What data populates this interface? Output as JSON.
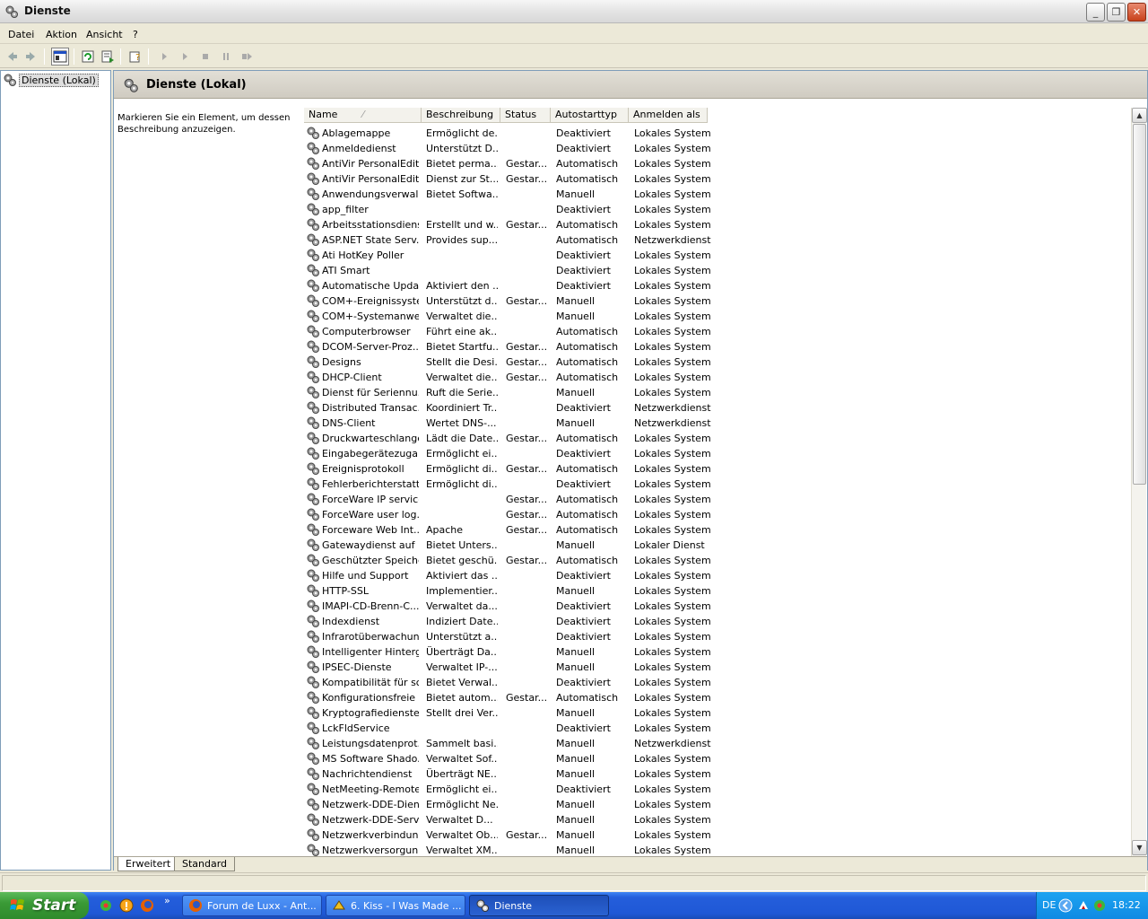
{
  "window": {
    "title": "Dienste"
  },
  "menu": [
    "Datei",
    "Aktion",
    "Ansicht",
    "?"
  ],
  "tree": {
    "root": "Dienste (Lokal)"
  },
  "pane": {
    "title": "Dienste (Lokal)",
    "description": "Markieren Sie ein Element, um dessen Beschreibung anzuzeigen."
  },
  "columns": [
    "Name",
    "Beschreibung",
    "Status",
    "Autostarttyp",
    "Anmelden als"
  ],
  "services": [
    [
      "Ablagemappe",
      "Ermöglicht de...",
      "",
      "Deaktiviert",
      "Lokales System"
    ],
    [
      "Anmeldedienst",
      "Unterstützt D...",
      "",
      "Deaktiviert",
      "Lokales System"
    ],
    [
      "AntiVir PersonalEditi...",
      "Bietet perma...",
      "Gestar...",
      "Automatisch",
      "Lokales System"
    ],
    [
      "AntiVir PersonalEditi...",
      "Dienst zur St...",
      "Gestar...",
      "Automatisch",
      "Lokales System"
    ],
    [
      "Anwendungsverwal...",
      "Bietet Softwa...",
      "",
      "Manuell",
      "Lokales System"
    ],
    [
      "app_filter",
      "",
      "",
      "Deaktiviert",
      "Lokales System"
    ],
    [
      "Arbeitsstationsdienst",
      "Erstellt und w...",
      "Gestar...",
      "Automatisch",
      "Lokales System"
    ],
    [
      "ASP.NET State Serv...",
      "Provides sup...",
      "",
      "Automatisch",
      "Netzwerkdienst"
    ],
    [
      "Ati HotKey Poller",
      "",
      "",
      "Deaktiviert",
      "Lokales System"
    ],
    [
      "ATI Smart",
      "",
      "",
      "Deaktiviert",
      "Lokales System"
    ],
    [
      "Automatische Updates",
      "Aktiviert den ...",
      "",
      "Deaktiviert",
      "Lokales System"
    ],
    [
      "COM+-Ereignissystem",
      "Unterstützt d...",
      "Gestar...",
      "Manuell",
      "Lokales System"
    ],
    [
      "COM+-Systemanwe...",
      "Verwaltet die...",
      "",
      "Manuell",
      "Lokales System"
    ],
    [
      "Computerbrowser",
      "Führt eine ak...",
      "",
      "Automatisch",
      "Lokales System"
    ],
    [
      "DCOM-Server-Proz...",
      "Bietet Startfu...",
      "Gestar...",
      "Automatisch",
      "Lokales System"
    ],
    [
      "Designs",
      "Stellt die Desi...",
      "Gestar...",
      "Automatisch",
      "Lokales System"
    ],
    [
      "DHCP-Client",
      "Verwaltet die...",
      "Gestar...",
      "Automatisch",
      "Lokales System"
    ],
    [
      "Dienst für Seriennu...",
      "Ruft die Serie...",
      "",
      "Manuell",
      "Lokales System"
    ],
    [
      "Distributed Transac...",
      "Koordiniert Tr...",
      "",
      "Deaktiviert",
      "Netzwerkdienst"
    ],
    [
      "DNS-Client",
      "Wertet DNS-...",
      "",
      "Manuell",
      "Netzwerkdienst"
    ],
    [
      "Druckwarteschlange",
      "Lädt die Date...",
      "Gestar...",
      "Automatisch",
      "Lokales System"
    ],
    [
      "Eingabegerätezugang",
      "Ermöglicht ei...",
      "",
      "Deaktiviert",
      "Lokales System"
    ],
    [
      "Ereignisprotokoll",
      "Ermöglicht di...",
      "Gestar...",
      "Automatisch",
      "Lokales System"
    ],
    [
      "Fehlerberichterstatt...",
      "Ermöglicht di...",
      "",
      "Deaktiviert",
      "Lokales System"
    ],
    [
      "ForceWare IP service",
      "",
      "Gestar...",
      "Automatisch",
      "Lokales System"
    ],
    [
      "ForceWare user log...",
      "",
      "Gestar...",
      "Automatisch",
      "Lokales System"
    ],
    [
      "Forceware Web Int...",
      "Apache",
      "Gestar...",
      "Automatisch",
      "Lokales System"
    ],
    [
      "Gatewaydienst auf ...",
      "Bietet Unters...",
      "",
      "Manuell",
      "Lokaler Dienst"
    ],
    [
      "Geschützter Speicher",
      "Bietet geschü...",
      "Gestar...",
      "Automatisch",
      "Lokales System"
    ],
    [
      "Hilfe und Support",
      "Aktiviert das ...",
      "",
      "Deaktiviert",
      "Lokales System"
    ],
    [
      "HTTP-SSL",
      "Implementier...",
      "",
      "Manuell",
      "Lokales System"
    ],
    [
      "IMAPI-CD-Brenn-C...",
      "Verwaltet da...",
      "",
      "Deaktiviert",
      "Lokales System"
    ],
    [
      "Indexdienst",
      "Indiziert Date...",
      "",
      "Deaktiviert",
      "Lokales System"
    ],
    [
      "Infrarotüberwachung",
      "Unterstützt a...",
      "",
      "Deaktiviert",
      "Lokales System"
    ],
    [
      "Intelligenter Hinterg...",
      "Überträgt Da...",
      "",
      "Manuell",
      "Lokales System"
    ],
    [
      "IPSEC-Dienste",
      "Verwaltet IP-...",
      "",
      "Manuell",
      "Lokales System"
    ],
    [
      "Kompatibilität für sc...",
      "Bietet Verwal...",
      "",
      "Deaktiviert",
      "Lokales System"
    ],
    [
      "Konfigurationsfreie ...",
      "Bietet autom...",
      "Gestar...",
      "Automatisch",
      "Lokales System"
    ],
    [
      "Kryptografiedienste",
      "Stellt drei Ver...",
      "",
      "Manuell",
      "Lokales System"
    ],
    [
      "LckFldService",
      "",
      "",
      "Deaktiviert",
      "Lokales System"
    ],
    [
      "Leistungsdatenprot...",
      "Sammelt basi...",
      "",
      "Manuell",
      "Netzwerkdienst"
    ],
    [
      "MS Software Shado...",
      "Verwaltet Sof...",
      "",
      "Manuell",
      "Lokales System"
    ],
    [
      "Nachrichtendienst",
      "Überträgt NE...",
      "",
      "Manuell",
      "Lokales System"
    ],
    [
      "NetMeeting-Remote...",
      "Ermöglicht ei...",
      "",
      "Deaktiviert",
      "Lokales System"
    ],
    [
      "Netzwerk-DDE-Dienst",
      "Ermöglicht Ne...",
      "",
      "Manuell",
      "Lokales System"
    ],
    [
      "Netzwerk-DDE-Serv...",
      "Verwaltet D...",
      "",
      "Manuell",
      "Lokales System"
    ],
    [
      "Netzwerkverbindun...",
      "Verwaltet Ob...",
      "Gestar...",
      "Manuell",
      "Lokales System"
    ],
    [
      "Netzwerkversorgun...",
      "Verwaltet XM...",
      "",
      "Manuell",
      "Lokales System"
    ]
  ],
  "tabs": [
    "Erweitert",
    "Standard"
  ],
  "taskbar": {
    "start": "Start",
    "tasks": [
      "Forum de Luxx - Ant...",
      "6. Kiss - I Was Made ...",
      "Dienste"
    ],
    "lang": "DE",
    "clock": "18:22"
  },
  "colors": {
    "taskbar": "#245edb",
    "start": "#3a9a36",
    "selection": "#dedede"
  }
}
